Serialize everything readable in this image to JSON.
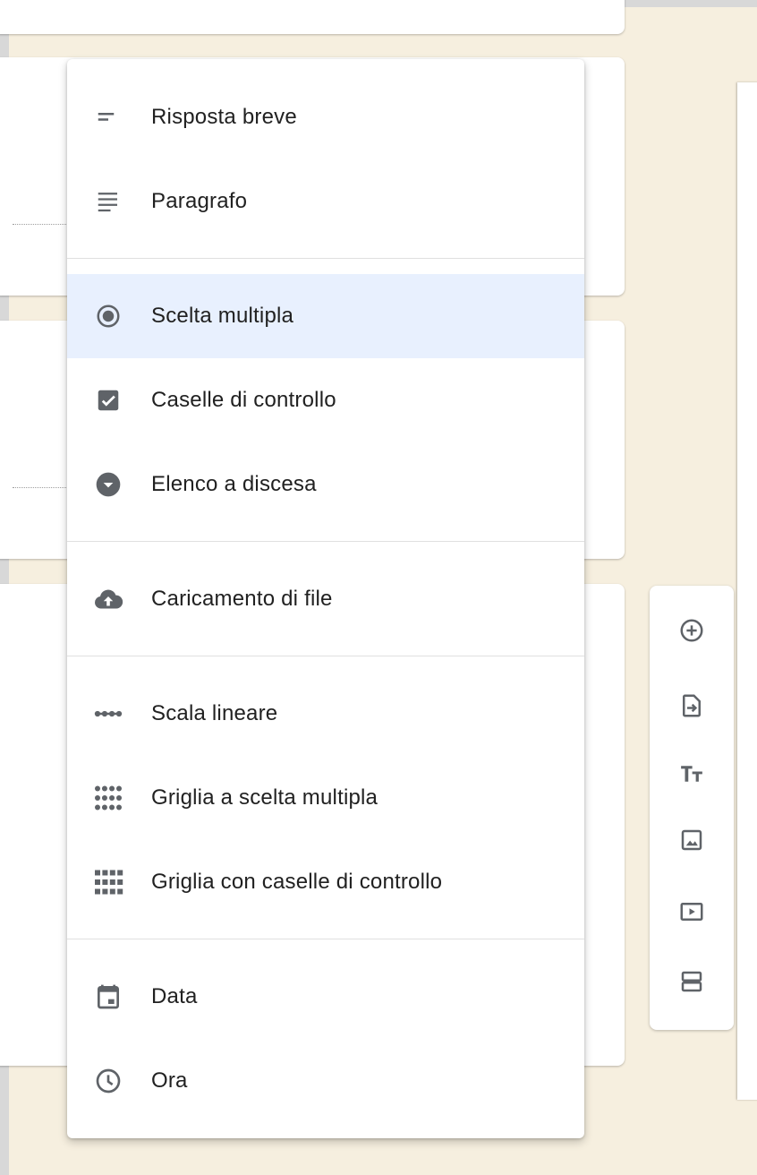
{
  "menu": {
    "items": [
      {
        "label": "Risposta breve",
        "icon": "short-answer-icon"
      },
      {
        "label": "Paragrafo",
        "icon": "paragraph-icon"
      },
      {
        "label": "Scelta multipla",
        "icon": "radio-button-icon",
        "selected": true
      },
      {
        "label": "Caselle di controllo",
        "icon": "checkbox-icon"
      },
      {
        "label": "Elenco a discesa",
        "icon": "dropdown-icon"
      },
      {
        "label": "Caricamento di file",
        "icon": "cloud-upload-icon"
      },
      {
        "label": "Scala lineare",
        "icon": "linear-scale-icon"
      },
      {
        "label": "Griglia a scelta multipla",
        "icon": "dot-grid-icon"
      },
      {
        "label": "Griglia con caselle di controllo",
        "icon": "checkbox-grid-icon"
      },
      {
        "label": "Data",
        "icon": "calendar-icon"
      },
      {
        "label": "Ora",
        "icon": "clock-icon"
      }
    ]
  },
  "toolbar": {
    "tools": [
      {
        "icon": "add-question-icon"
      },
      {
        "icon": "import-questions-icon"
      },
      {
        "icon": "title-text-icon"
      },
      {
        "icon": "image-icon"
      },
      {
        "icon": "video-icon"
      },
      {
        "icon": "section-icon"
      }
    ]
  },
  "colors": {
    "background": "#f6efdf",
    "selected_item": "#e8f0fe",
    "icon": "#5f6368",
    "text": "#212121"
  }
}
